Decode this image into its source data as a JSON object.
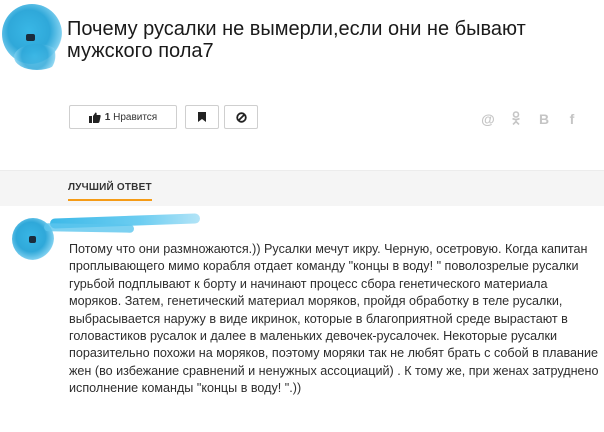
{
  "question": {
    "title": "Почему русалки не вымерли,если они не бывают мужского пола7"
  },
  "actions": {
    "like_count": "1",
    "like_label": "Нравится",
    "like_icon": "thumbs-up-icon",
    "bookmark_icon": "bookmark-icon",
    "block_icon": "block-icon"
  },
  "share": [
    "@",
    "ok-icon",
    "В",
    "f"
  ],
  "best_answer": {
    "label": "ЛУЧШИЙ ОТВЕТ",
    "accent_color": "#f59b16",
    "text": "Потому что они размножаются.)) Русалки мечут икру. Черную, осетровую. Когда капитан проплывающего мимо корабля отдает команду \"концы в воду! \" поволозрелые русалки гурьбой подплывают к борту и начинают процесс сбора генетического материала моряков. Затем, генетический материал моряков, пройдя обработку в теле русалки, выбрасывается наружу в виде икринок, которые в благоприятной среде вырастают в головастиков русалок и далее в маленьких девочек-русалочек. Некоторые русалки поразительно похожи на моряков, поэтому моряки так не любят брать с собой в плавание жен (во избежание сравнений и ненужных ассоциаций) . К тому же, при женах затруднено исполнение команды \"концы в воду! \".))"
  }
}
